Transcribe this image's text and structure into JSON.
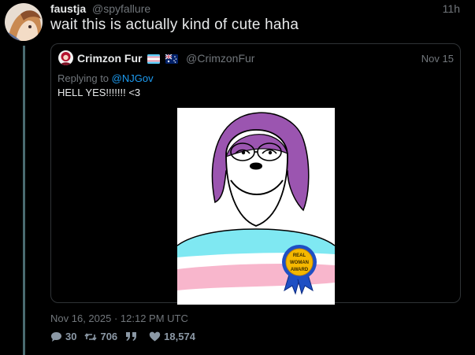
{
  "post": {
    "author_name": "faustja",
    "author_handle": "@spyfallure",
    "time": "11h",
    "text": "wait this is actually kind of cute haha"
  },
  "quote": {
    "author_name": "Crimzon Fur",
    "author_handle": "@CrimzonFur",
    "date": "Nov 15",
    "replying_to_label": "Replying to",
    "replying_to_handle": "@NJGov",
    "text": "HELL YES!!!!!!! <3",
    "image": {
      "badge_line1": "REAL",
      "badge_line2": "WOMAN",
      "badge_line3": "AWARD"
    }
  },
  "meta": {
    "timestamp": "Nov 16, 2025 · 12:12 PM UTC"
  },
  "stats": {
    "replies": "30",
    "retweets": "706",
    "likes": "18,574"
  },
  "icons": {
    "reply": "comment-icon",
    "retweet": "retweet-icon",
    "quote": "quote-icon",
    "like": "heart-icon"
  },
  "colors": {
    "background": "#000000",
    "text": "#e7e9ea",
    "muted": "#71767b",
    "link": "#1d9bf0",
    "thread_line": "#4a6b70"
  }
}
